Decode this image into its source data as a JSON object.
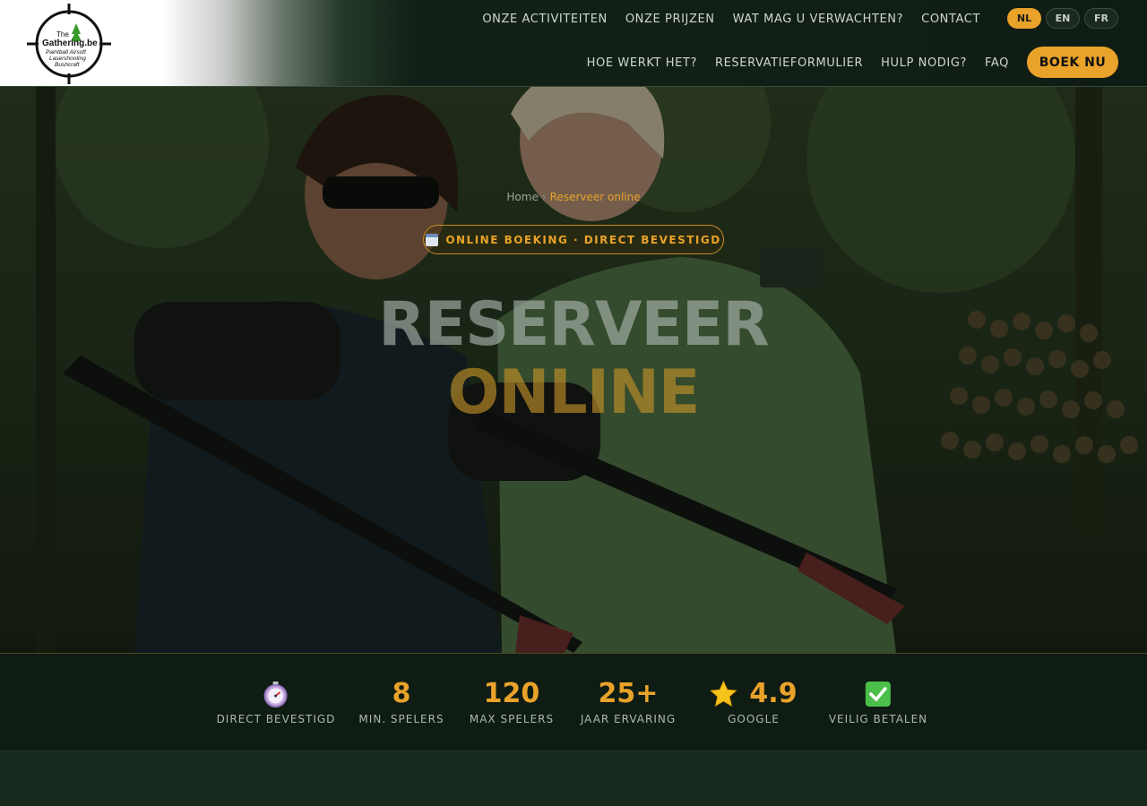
{
  "logo": {
    "line1": "The",
    "line2": "Gathering.be",
    "line3": "Paintball  Airsoft",
    "line4": "Lasershooting",
    "line5": "Bushcraft"
  },
  "nav": {
    "row1": [
      "ONZE ACTIVITEITEN",
      "ONZE PRIJZEN",
      "WAT MAG U VERWACHTEN?",
      "CONTACT"
    ],
    "row2": [
      "HOE WERKT HET?",
      "RESERVATIEFORMULIER",
      "HULP NODIG?",
      "FAQ"
    ]
  },
  "languages": [
    {
      "code": "NL",
      "active": true
    },
    {
      "code": "EN",
      "active": false
    },
    {
      "code": "FR",
      "active": false
    }
  ],
  "book_button": "BOEK NU",
  "breadcrumb": {
    "home": "Home",
    "separator": "›",
    "current": "Reserveer online"
  },
  "badge": {
    "icon": "calendar-icon",
    "text": "ONLINE BOEKING · DIRECT BEVESTIGD"
  },
  "hero": {
    "title_line1": "RESERVEER",
    "title_line2": "ONLINE"
  },
  "stats": [
    {
      "icon": "stopwatch-icon",
      "value": "",
      "label": "DIRECT BEVESTIGD"
    },
    {
      "icon": "",
      "value": "8",
      "label": "MIN. SPELERS"
    },
    {
      "icon": "",
      "value": "120",
      "label": "MAX SPELERS"
    },
    {
      "icon": "",
      "value": "25+",
      "label": "JAAR ERVARING"
    },
    {
      "icon": "star-icon",
      "value": "4.9",
      "label": "GOOGLE"
    },
    {
      "icon": "check-mark-icon",
      "value": "",
      "label": "VEILIG BETALEN"
    }
  ],
  "colors": {
    "accent": "#e9a22a",
    "header_dark": "#0f1c13",
    "stats_bg": "#0f1c13",
    "page_bg": "#172a1d"
  }
}
